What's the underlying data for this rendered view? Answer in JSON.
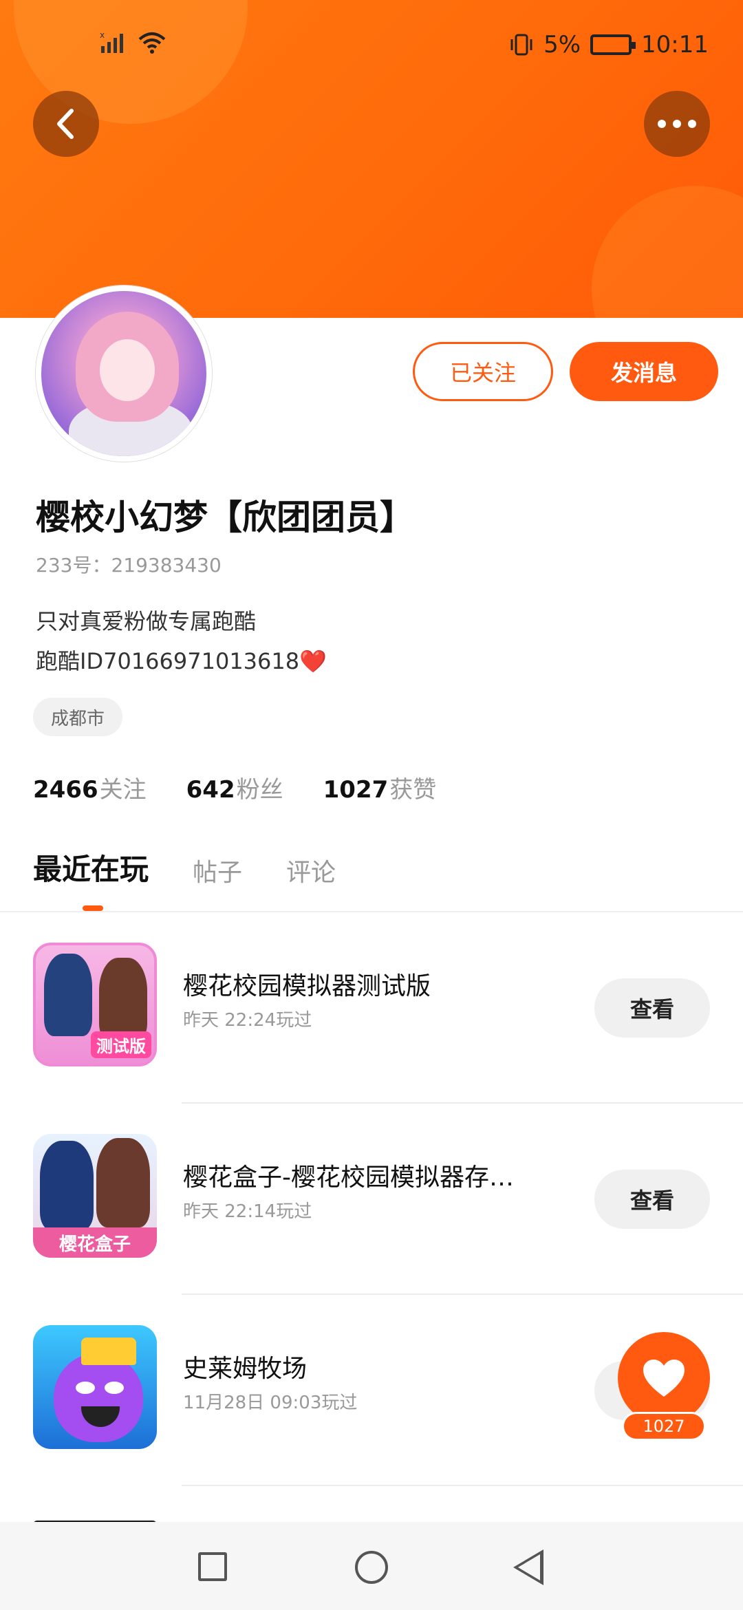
{
  "status_bar": {
    "time": "10:11",
    "battery_percent": "5%"
  },
  "header": {
    "back_icon": "chevron-left-icon",
    "more_icon": "more-dots-icon"
  },
  "profile": {
    "followed_label": "已关注",
    "message_label": "发消息",
    "username": "樱校小幻梦【欣团团员】",
    "user_id": "233号：219383430",
    "bio_line1": "只对真爱粉做专属跑酷",
    "bio_line2": "跑酷ID70166971013618❤️",
    "location": "成都市",
    "stats": [
      {
        "num": "2466",
        "label": "关注"
      },
      {
        "num": "642",
        "label": "粉丝"
      },
      {
        "num": "1027",
        "label": "获赞"
      }
    ]
  },
  "tabs": [
    {
      "label": "最近在玩",
      "active": true
    },
    {
      "label": "帖子",
      "active": false
    },
    {
      "label": "评论",
      "active": false
    }
  ],
  "games": [
    {
      "title": "樱花校园模拟器测试版",
      "time": "昨天 22:24玩过",
      "button": "查看",
      "icon_badge": "测试版"
    },
    {
      "title": "樱花盒子-樱花校园模拟器存…",
      "time": "昨天 22:14玩过",
      "button": "查看",
      "icon_badge": "樱花盒子"
    },
    {
      "title": "史莱姆牧场",
      "time": "11月28日 09:03玩过",
      "button": "查看"
    }
  ],
  "like_fab": {
    "count": "1027"
  },
  "colors": {
    "accent": "#ff5a10",
    "banner": "#ff7a10"
  }
}
